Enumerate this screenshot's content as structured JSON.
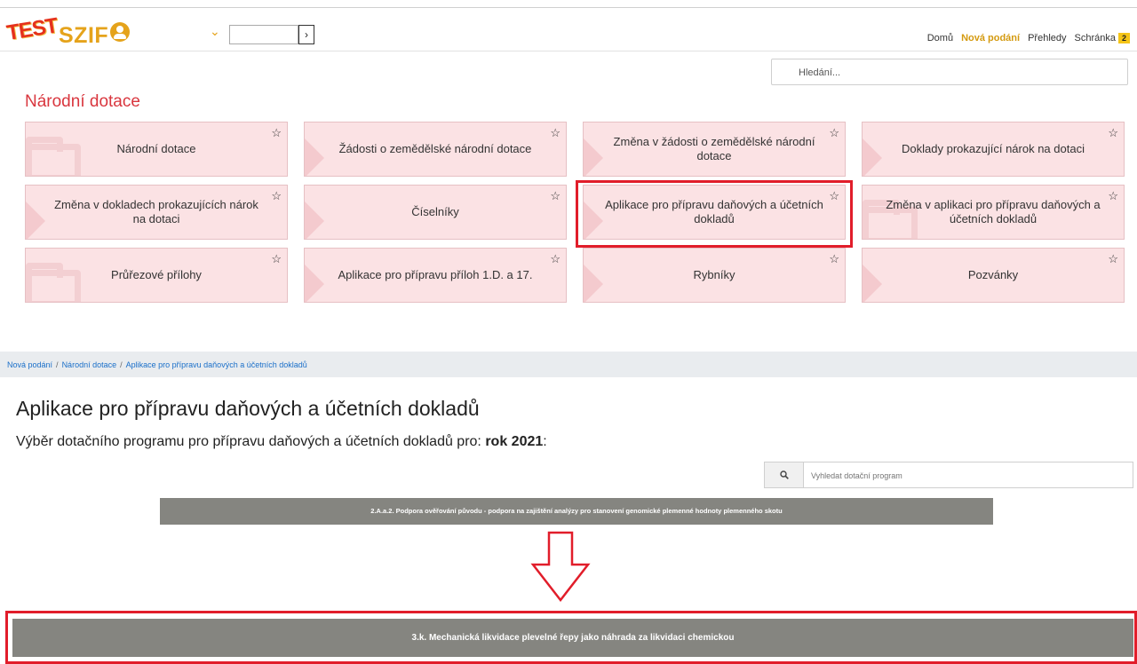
{
  "header": {
    "logo_test": "TEST",
    "logo_szif": "SZIF",
    "nav": [
      {
        "label": "Domů",
        "active": false
      },
      {
        "label": "Nová podání",
        "active": true
      },
      {
        "label": "Přehledy",
        "active": false
      },
      {
        "label": "Schránka",
        "active": false
      }
    ],
    "inbox_count": "2"
  },
  "search": {
    "placeholder": "Hledání..."
  },
  "section_title": "Národní dotace",
  "tiles": [
    {
      "label": "Národní dotace",
      "deco": "folder"
    },
    {
      "label": "Žádosti o zemědělské národní dotace",
      "deco": "arrow"
    },
    {
      "label": "Změna v žádosti o zemědělské národní dotace",
      "deco": "arrow"
    },
    {
      "label": "Doklady prokazující nárok na dotaci",
      "deco": "arrow"
    },
    {
      "label": "Změna v dokladech prokazujících nárok na dotaci",
      "deco": "arrow"
    },
    {
      "label": "Číselníky",
      "deco": "arrow"
    },
    {
      "label": "Aplikace pro přípravu daňových a účetních dokladů",
      "deco": "arrow"
    },
    {
      "label": "Změna v aplikaci pro přípravu daňových a účetních dokladů",
      "deco": "folder"
    },
    {
      "label": "Průřezové přílohy",
      "deco": "folder"
    },
    {
      "label": "Aplikace pro přípravu příloh 1.D. a 17.",
      "deco": "arrow"
    },
    {
      "label": "Rybníky",
      "deco": "arrow"
    },
    {
      "label": "Pozvánky",
      "deco": "arrow"
    }
  ],
  "breadcrumb": [
    "Nová podání",
    "Národní dotace",
    "Aplikace pro přípravu daňových a účetních dokladů"
  ],
  "page_heading": "Aplikace pro přípravu daňových a účetních dokladů",
  "subheading": {
    "text": "Výběr dotačního programu pro přípravu daňových a účetních dokladů pro: ",
    "year": "rok 2021",
    "suffix": ":"
  },
  "program_search": {
    "placeholder": "Vyhledat dotační program"
  },
  "programs": {
    "first": "2.A.a.2. Podpora ověřování původu - podpora na zajištění analýzy pro stanovení genomické plemenné hodnoty plemenného skotu",
    "second": "3.k. Mechanická likvidace plevelné řepy jako náhrada za likvidaci chemickou"
  },
  "colors": {
    "accent": "#e5a31b",
    "section_title": "#d9363e",
    "tile_bg": "#fbe2e4",
    "highlight": "#e11d2a",
    "program_bar": "#858580"
  }
}
